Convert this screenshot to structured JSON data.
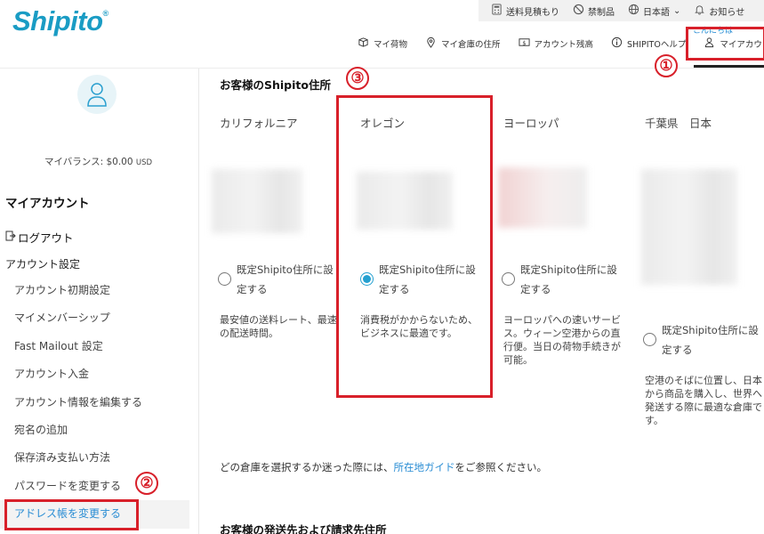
{
  "header": {
    "logo": "Shipito",
    "logo_mark": "®",
    "topbar": [
      {
        "icon": "calculator-icon",
        "label": "送料見積もり"
      },
      {
        "icon": "prohibited-icon",
        "label": "禁制品"
      },
      {
        "icon": "globe-icon",
        "label": "日本語"
      },
      {
        "icon": "bell-icon",
        "label": "お知らせ"
      }
    ],
    "greeting": "こんにちは",
    "nav": [
      {
        "icon": "package-icon",
        "label": "マイ荷物"
      },
      {
        "icon": "location-pin-icon",
        "label": "マイ倉庫の住所"
      },
      {
        "icon": "dollar-icon",
        "label": "アカウント残高"
      },
      {
        "icon": "info-icon",
        "label": "SHIPITOヘルプ"
      },
      {
        "icon": "user-icon",
        "label": "マイアカウント"
      }
    ]
  },
  "sidebar": {
    "balance_label": "マイバランス: $0.00",
    "balance_currency": "USD",
    "title": "マイアカウント",
    "logout": "ログアウト",
    "settings_heading": "アカウント設定",
    "items": [
      "アカウント初期設定",
      "マイメンバーシップ",
      "Fast Mailout 設定",
      "アカウント入金",
      "アカウント情報を編集する",
      "宛名の追加",
      "保存済み支払い方法",
      "パスワードを変更する",
      "アドレス帳を変更する"
    ]
  },
  "content": {
    "section_title": "お客様のShipito住所",
    "warehouses": [
      {
        "name": "カリフォルニア",
        "radio_label": "既定Shipito住所に設定する",
        "selected": false,
        "description": "最安値の送料レート、最速の配送時間。"
      },
      {
        "name": "オレゴン",
        "radio_label": "既定Shipito住所に設定する",
        "selected": true,
        "description": "消費税がかからないため、ビジネスに最適です。"
      },
      {
        "name": "ヨーロッパ",
        "radio_label": "既定Shipito住所に設定する",
        "selected": false,
        "description": "ヨーロッパへの速いサービス。ウィーン空港からの直行便。当日の荷物手続きが可能。"
      },
      {
        "name": "千葉県　日本",
        "radio_label": "既定Shipito住所に設定する",
        "selected": false,
        "description": "空港のそばに位置し、日本から商品を購入し、世界へ発送する際に最適な倉庫です。"
      }
    ],
    "guide_prefix": "どの倉庫を選択するか迷った際には、",
    "guide_link": "所在地ガイド",
    "guide_suffix": "をご参照ください。",
    "section_title2": "お客様の発送先および請求先住所"
  },
  "annotations": {
    "marker1": "①",
    "marker2": "②",
    "marker3": "③",
    "color": "#d8202a"
  },
  "colors": {
    "brand": "#1a9cc4",
    "link": "#2a8dd4",
    "radio_selected": "#24a0d0"
  }
}
